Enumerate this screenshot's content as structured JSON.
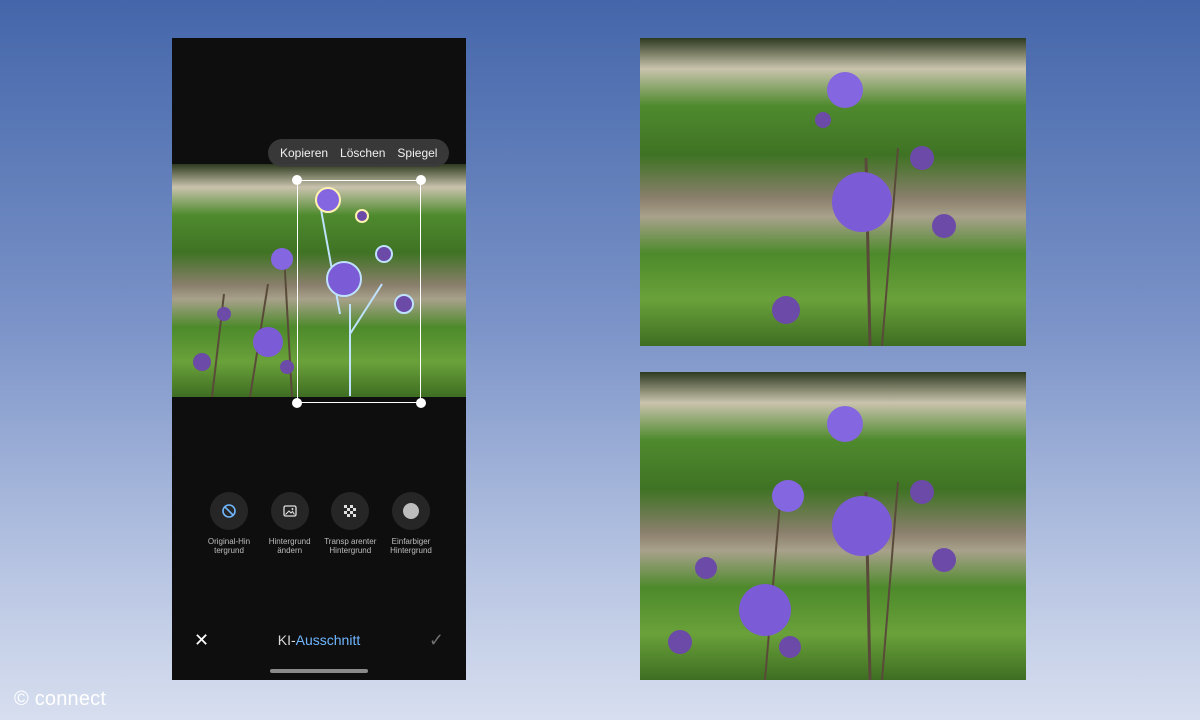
{
  "context_menu": {
    "copy": "Kopieren",
    "delete": "Löschen",
    "mirror": "Spiegel"
  },
  "options": [
    {
      "label": "Original-Hin tergrund",
      "icon": "ban-icon",
      "selected": true
    },
    {
      "label": "Hintergrund ändern",
      "icon": "image-icon",
      "selected": false
    },
    {
      "label": "Transp arenter Hintergrund",
      "icon": "checkerboard-icon",
      "selected": false
    },
    {
      "label": "Einfarbiger Hintergrund",
      "icon": "solid-circle-icon",
      "selected": false
    }
  ],
  "bottom_bar": {
    "title_prefix": "KI-",
    "title_highlight": "Ausschnitt",
    "close": "✕",
    "confirm": "✓"
  },
  "watermark": "© connect",
  "colors": {
    "accent": "#6fb6ff",
    "outline": "#bfe3ff",
    "flower": "#7b5bd6",
    "foliage": "#4a8a2a"
  }
}
